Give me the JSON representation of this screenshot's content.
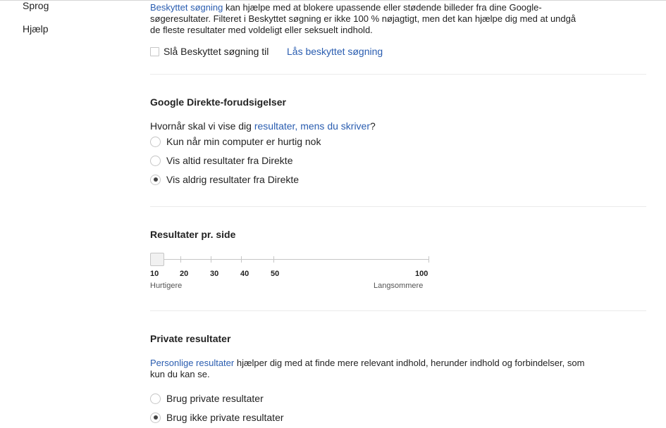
{
  "sidebar": {
    "items": [
      {
        "label": "Sprog"
      },
      {
        "label": "Hjælp"
      }
    ]
  },
  "safesearch": {
    "intro_link": "Beskyttet søgning",
    "intro_line1_rest": " kan hjælpe med at blokere upassende eller stødende billeder fra dine Google-",
    "intro_line2": "søgeresultater. Filteret i Beskyttet søgning er ikke 100 % nøjagtigt, men det kan hjælpe dig med at undgå",
    "intro_line3": "de fleste resultater med voldeligt eller seksuelt indhold.",
    "checkbox_label": "Slå Beskyttet søgning til",
    "checkbox_checked": false,
    "lock_link": "Lås beskyttet søgning"
  },
  "instant": {
    "heading": "Google Direkte-forudsigelser",
    "question_pre": "Hvornår skal vi vise dig ",
    "question_link": "resultater, mens du skriver",
    "question_post": "?",
    "options": [
      {
        "label": "Kun når min computer er hurtig nok",
        "checked": false
      },
      {
        "label": "Vis altid resultater fra Direkte",
        "checked": false
      },
      {
        "label": "Vis aldrig resultater fra Direkte",
        "checked": true
      }
    ]
  },
  "results_per_page": {
    "heading": "Resultater pr. side",
    "ticks": [
      "10",
      "20",
      "30",
      "40",
      "50",
      "100"
    ],
    "selected": "10",
    "left_caption": "Hurtigere",
    "right_caption": "Langsommere"
  },
  "private": {
    "heading": "Private resultater",
    "desc_link": "Personlige resultater",
    "desc_line1_rest": " hjælper dig med at finde mere relevant indhold, herunder indhold og forbindelser, som",
    "desc_line2": "kun du kan se.",
    "options": [
      {
        "label": "Brug private resultater",
        "checked": false
      },
      {
        "label": "Brug ikke private resultater",
        "checked": true
      }
    ]
  }
}
